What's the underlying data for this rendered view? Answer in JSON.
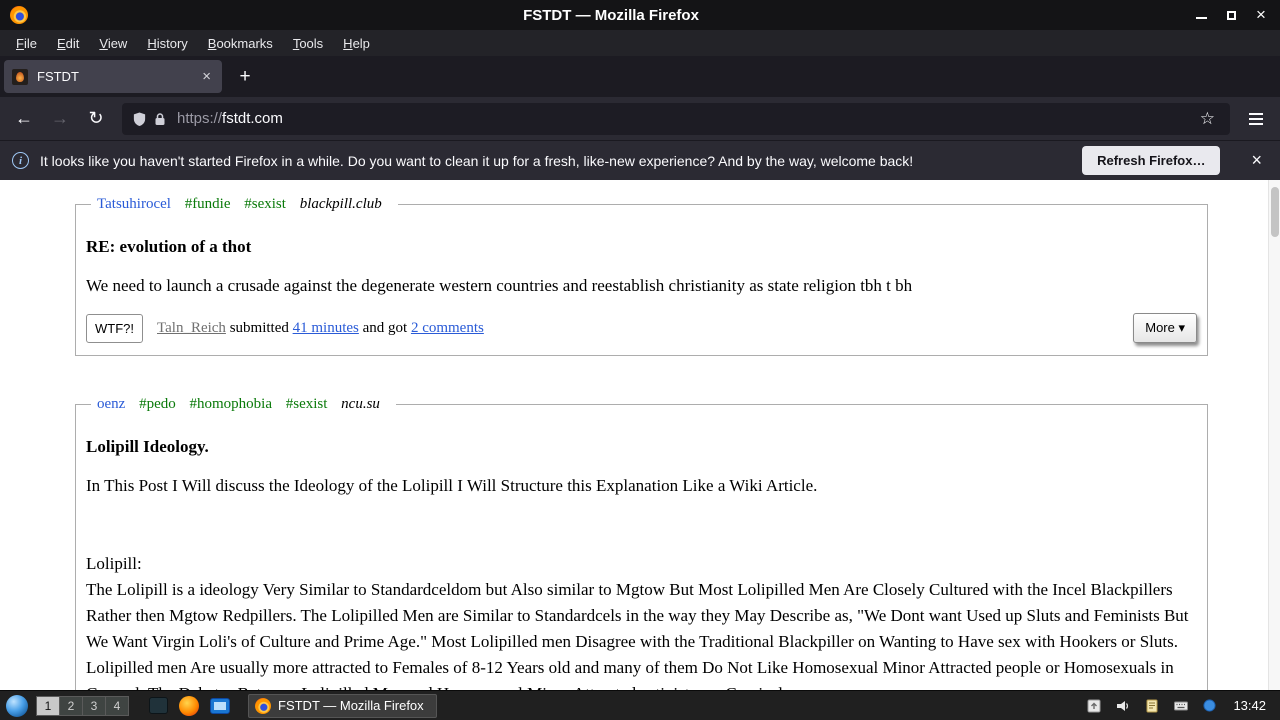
{
  "window": {
    "title": "FSTDT — Mozilla Firefox"
  },
  "glyphs": {
    "close": "×",
    "plus": "+",
    "back": "←",
    "forward": "→",
    "reload": "↻",
    "star": "☆",
    "info": "i"
  },
  "menubar": {
    "items": [
      "File",
      "Edit",
      "View",
      "History",
      "Bookmarks",
      "Tools",
      "Help"
    ]
  },
  "tabs": {
    "active_title": "FSTDT"
  },
  "navbar": {
    "url_scheme": "https://",
    "url_host": "fstdt.com"
  },
  "notification": {
    "message": "It looks like you haven't started Firefox in a while. Do you want to clean it up for a fresh, like-new experience? And by the way, welcome back!",
    "button_label": "Refresh Firefox…"
  },
  "posts": [
    {
      "author": "Tatsuhirocel",
      "tags": [
        "#fundie",
        "#sexist"
      ],
      "source": "blackpill.club",
      "title": "RE: evolution of a thot",
      "body": "We need to launch a crusade against the degenerate western countries and reestablish christianity as state religion tbh t bh",
      "footer": {
        "wtf_label": "WTF?!",
        "submitter": "Taln_Reich",
        "submitted_word": "submitted",
        "time_link": "41 minutes",
        "and_got_word": "and got",
        "comments_link": "2 comments",
        "more_label": "More ▾"
      }
    },
    {
      "author": "oenz",
      "tags": [
        "#pedo",
        "#homophobia",
        "#sexist"
      ],
      "source": "ncu.su",
      "title": "Lolipill Ideology.",
      "body_lines": [
        "In This Post I Will discuss the Ideology of the Lolipill I Will Structure this Explanation Like a Wiki Article.",
        "",
        "",
        "Lolipill:",
        "The Lolipill is a ideology Very Similar to Standardceldom but Also similar to Mgtow But Most Lolipilled Men Are Closely Cultured with the Incel Blackpillers Rather then Mgtow Redpillers. The Lolipilled Men are Similar to Standardcels in the way they May Describe as, \"We Dont want Used up Sluts and Feminists But We Want Virgin Loli's of Culture and Prime Age.\" Most Lolipilled men Disagree with the Traditional Blackpiller on Wanting to Have sex with Hookers or Sluts. Lolipilled men Are usually more attracted to Females of 8-12 Years old and many of them Do Not Like Homosexual Minor Attracted people or Homosexuals in General. The Debates Between Lolipilled Men and Homosexual Minor Attracted activists are Comical"
      ]
    }
  ],
  "taskbar": {
    "workspaces": [
      "1",
      "2",
      "3",
      "4"
    ],
    "window_button": "FSTDT — Mozilla Firefox",
    "clock": "13:42"
  },
  "colors": {
    "link_blue": "#2a5bd7",
    "tag_green": "#0a7a0a",
    "active_tab": "#42414d",
    "toolbar_dark": "#2b2a33"
  }
}
